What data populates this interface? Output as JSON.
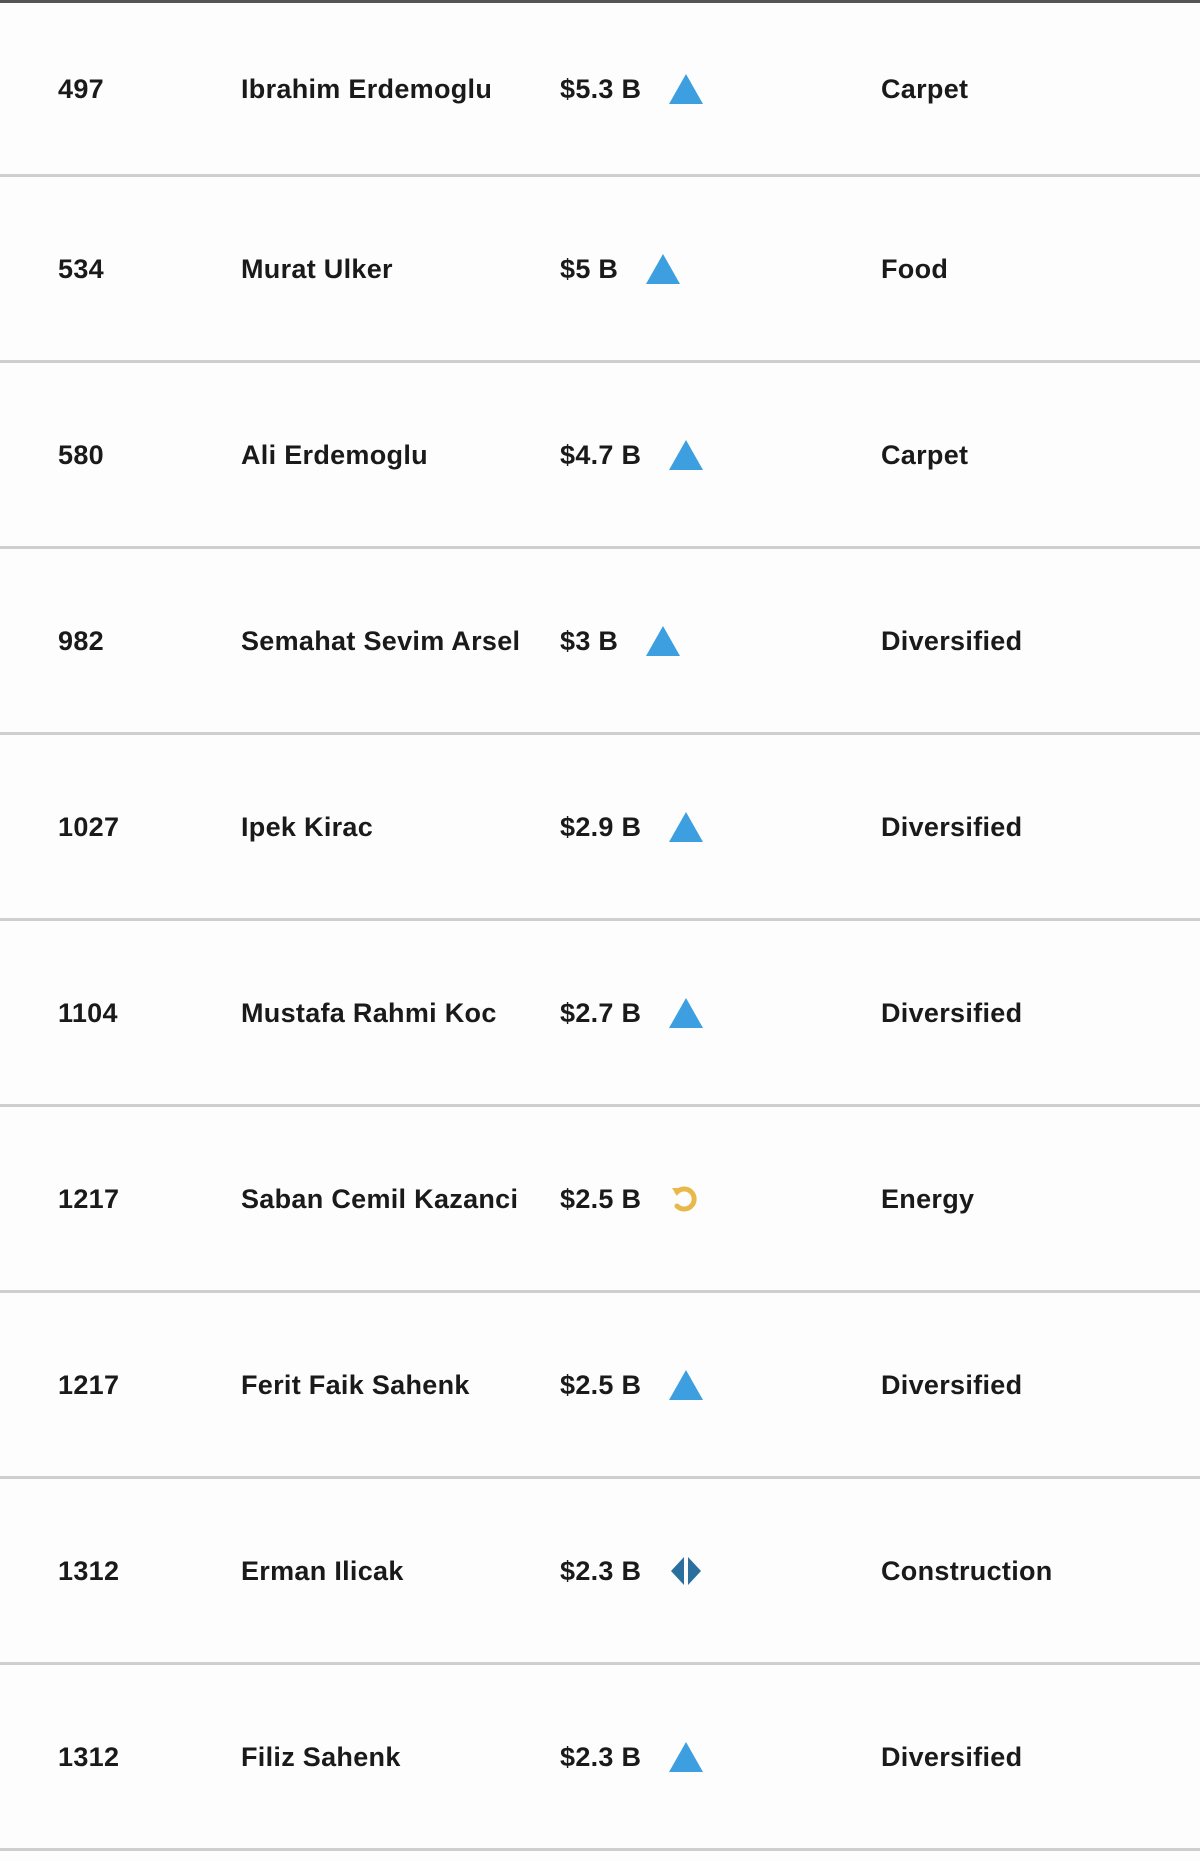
{
  "colors": {
    "up": "#3d9fe0",
    "unchanged": "#2a6f9e",
    "returning": "#e8b84a"
  },
  "rows": [
    {
      "rank": "497",
      "name": "Ibrahim Erdemoglu",
      "worth": "$5.3 B",
      "trend": "up",
      "industry": "Carpet"
    },
    {
      "rank": "534",
      "name": "Murat Ulker",
      "worth": "$5 B",
      "trend": "up",
      "industry": "Food"
    },
    {
      "rank": "580",
      "name": "Ali Erdemoglu",
      "worth": "$4.7 B",
      "trend": "up",
      "industry": "Carpet"
    },
    {
      "rank": "982",
      "name": "Semahat Sevim Arsel",
      "worth": "$3 B",
      "trend": "up",
      "industry": "Diversified"
    },
    {
      "rank": "1027",
      "name": "Ipek Kirac",
      "worth": "$2.9 B",
      "trend": "up",
      "industry": "Diversified"
    },
    {
      "rank": "1104",
      "name": "Mustafa Rahmi Koc",
      "worth": "$2.7 B",
      "trend": "up",
      "industry": "Diversified"
    },
    {
      "rank": "1217",
      "name": "Saban Cemil Kazanci",
      "worth": "$2.5 B",
      "trend": "returning",
      "industry": "Energy"
    },
    {
      "rank": "1217",
      "name": "Ferit Faik Sahenk",
      "worth": "$2.5 B",
      "trend": "up",
      "industry": "Diversified"
    },
    {
      "rank": "1312",
      "name": "Erman Ilicak",
      "worth": "$2.3 B",
      "trend": "unchanged",
      "industry": "Construction"
    },
    {
      "rank": "1312",
      "name": "Filiz Sahenk",
      "worth": "$2.3 B",
      "trend": "up",
      "industry": "Diversified"
    }
  ]
}
